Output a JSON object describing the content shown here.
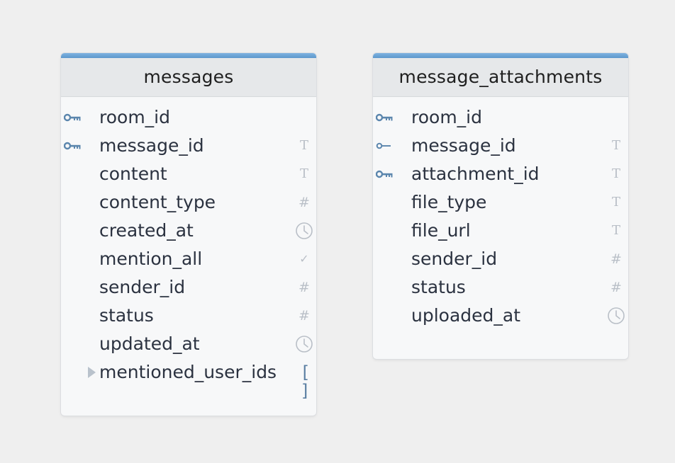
{
  "entities": [
    {
      "name": "messages",
      "fields": [
        {
          "name": "room_id",
          "key": "primary",
          "type_icon": "none"
        },
        {
          "name": "message_id",
          "key": "primary",
          "type_icon": "text"
        },
        {
          "name": "content",
          "key": "none",
          "type_icon": "text"
        },
        {
          "name": "content_type",
          "key": "none",
          "type_icon": "number"
        },
        {
          "name": "created_at",
          "key": "none",
          "type_icon": "timestamp"
        },
        {
          "name": "mention_all",
          "key": "none",
          "type_icon": "boolean"
        },
        {
          "name": "sender_id",
          "key": "none",
          "type_icon": "number"
        },
        {
          "name": "status",
          "key": "none",
          "type_icon": "number"
        },
        {
          "name": "updated_at",
          "key": "none",
          "type_icon": "timestamp"
        },
        {
          "name": "mentioned_user_ids",
          "key": "none",
          "type_icon": "array",
          "expandable": true
        }
      ]
    },
    {
      "name": "message_attachments",
      "fields": [
        {
          "name": "room_id",
          "key": "primary",
          "type_icon": "none"
        },
        {
          "name": "message_id",
          "key": "foreign",
          "type_icon": "text"
        },
        {
          "name": "attachment_id",
          "key": "primary",
          "type_icon": "text"
        },
        {
          "name": "file_type",
          "key": "none",
          "type_icon": "text"
        },
        {
          "name": "file_url",
          "key": "none",
          "type_icon": "text"
        },
        {
          "name": "sender_id",
          "key": "none",
          "type_icon": "number"
        },
        {
          "name": "status",
          "key": "none",
          "type_icon": "number"
        },
        {
          "name": "uploaded_at",
          "key": "none",
          "type_icon": "timestamp"
        }
      ]
    }
  ],
  "type_glyphs": {
    "text": "T",
    "number": "#",
    "boolean": "✓",
    "array": "[ ]"
  },
  "colors": {
    "header_stripe": "#6fa6d8",
    "key_icon": "#5b86ad",
    "type_icon": "#b9bfc7",
    "array_icon": "#5b7fa3",
    "field_text": "#2b3240"
  }
}
